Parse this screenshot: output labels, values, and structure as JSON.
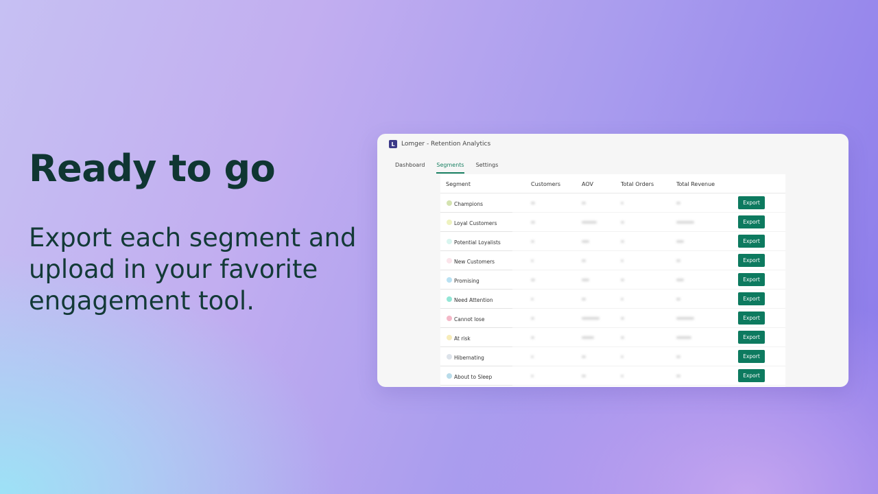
{
  "hero": {
    "title": "Ready to go",
    "body": "Export each segment and upload in your favorite engagement tool."
  },
  "window": {
    "logo_letter": "L",
    "title": "Lomger - Retention Analytics"
  },
  "tabs": [
    {
      "label": "Dashboard",
      "active": false
    },
    {
      "label": "Segments",
      "active": true
    },
    {
      "label": "Settings",
      "active": false
    }
  ],
  "table": {
    "columns": [
      "Segment",
      "Customers",
      "AOV",
      "Total Orders",
      "Total Revenue"
    ],
    "export_label": "Export",
    "rows": [
      {
        "name": "Champions",
        "color": "#d4e3b0"
      },
      {
        "name": "Loyal Customers",
        "color": "#eef2bf"
      },
      {
        "name": "Potential Loyalists",
        "color": "#d8f5ef"
      },
      {
        "name": "New Customers",
        "color": "#fbe4ea"
      },
      {
        "name": "Promising",
        "color": "#b9e1f2"
      },
      {
        "name": "Need Attention",
        "color": "#93e6d6"
      },
      {
        "name": "Cannot lose",
        "color": "#f4b8c8"
      },
      {
        "name": "At risk",
        "color": "#f7ecb9"
      },
      {
        "name": "Hibernating",
        "color": "#dde3ea"
      },
      {
        "name": "About to Sleep",
        "color": "#b9dcea"
      }
    ]
  }
}
